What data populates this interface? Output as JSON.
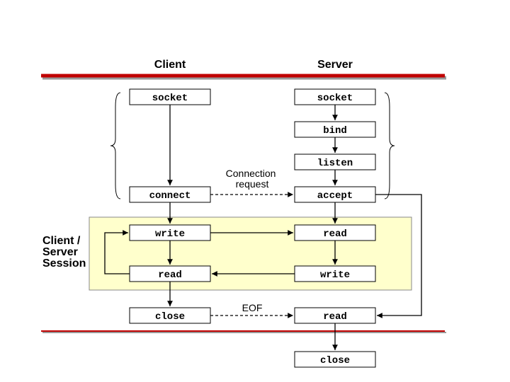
{
  "headers": {
    "client": "Client",
    "server": "Server"
  },
  "client": {
    "socket": "socket",
    "connect": "connect",
    "write": "write",
    "read": "read",
    "close": "close"
  },
  "server": {
    "socket": "socket",
    "bind": "bind",
    "listen": "listen",
    "accept": "accept",
    "read": "read",
    "write": "write",
    "read2": "read",
    "close": "close"
  },
  "labels": {
    "conn_req": "Connection\nrequest",
    "eof": "EOF",
    "session": "Client /\nServer\nSession"
  },
  "colors": {
    "rule": "#c00000",
    "shadow": "#999999",
    "session_fill": "#ffffcc"
  }
}
